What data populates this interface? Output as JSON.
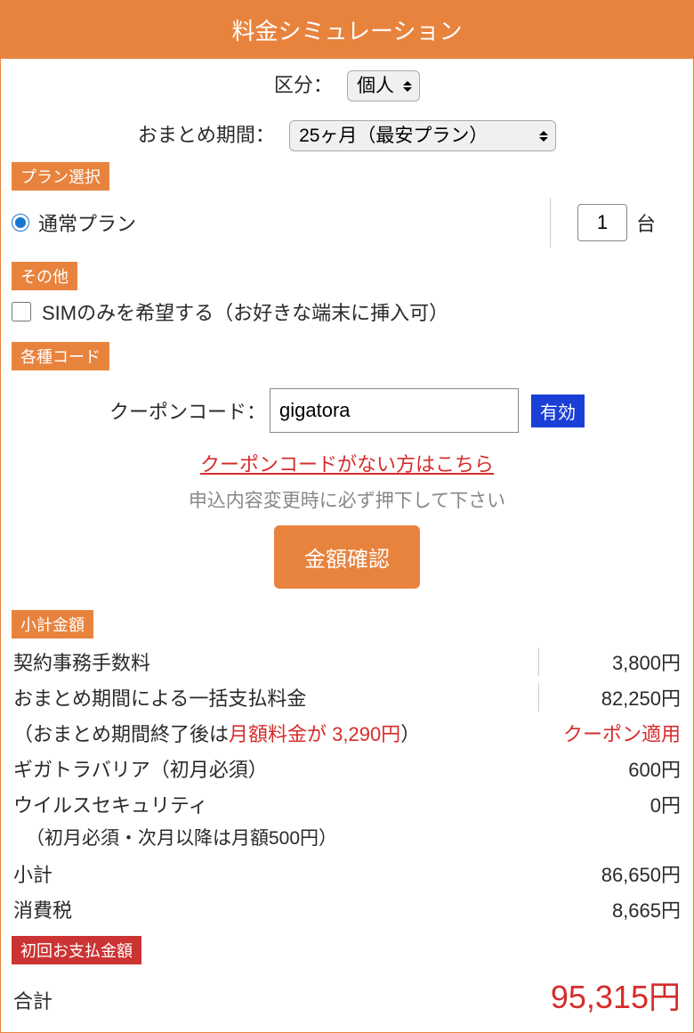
{
  "header": {
    "title": "料金シミュレーション"
  },
  "category": {
    "label": "区分：",
    "selected": "個人"
  },
  "period": {
    "label": "おまとめ期間：",
    "selected": "25ヶ月（最安プラン）"
  },
  "sections": {
    "plan": "プラン選択",
    "other": "その他",
    "codes": "各種コード",
    "subtotal": "小計金額",
    "first_payment": "初回お支払金額"
  },
  "plan": {
    "normal_label": "通常プラン",
    "qty_value": "1",
    "unit": "台"
  },
  "other": {
    "sim_only_label": "SIMのみを希望する（お好きな端末に挿入可）"
  },
  "coupon": {
    "label": "クーポンコード：",
    "value": "gigatora",
    "badge": "有効",
    "link_text": "クーポンコードがない方はこちら",
    "note": "申込内容変更時に必ず押下して下さい",
    "confirm_button": "金額確認"
  },
  "costs": {
    "admin_fee_label": "契約事務手数料",
    "admin_fee_value": "3,800円",
    "lump_label": "おまとめ期間による一括支払料金",
    "lump_value": "82,250円",
    "post_period_prefix": "（おまとめ期間終了後は",
    "post_period_red": "月額料金が 3,290円",
    "post_period_suffix": "）",
    "coupon_applied": "クーポン適用",
    "barrier_label": "ギガトラバリア（初月必須）",
    "barrier_value": "600円",
    "virus_label": "ウイルスセキュリティ",
    "virus_value": "0円",
    "virus_note": "（初月必須・次月以降は月額500円）",
    "subtotal_label": "小計",
    "subtotal_value": "86,650円",
    "tax_label": "消費税",
    "tax_value": "8,665円"
  },
  "total": {
    "label": "合計",
    "value": "95,315円"
  }
}
